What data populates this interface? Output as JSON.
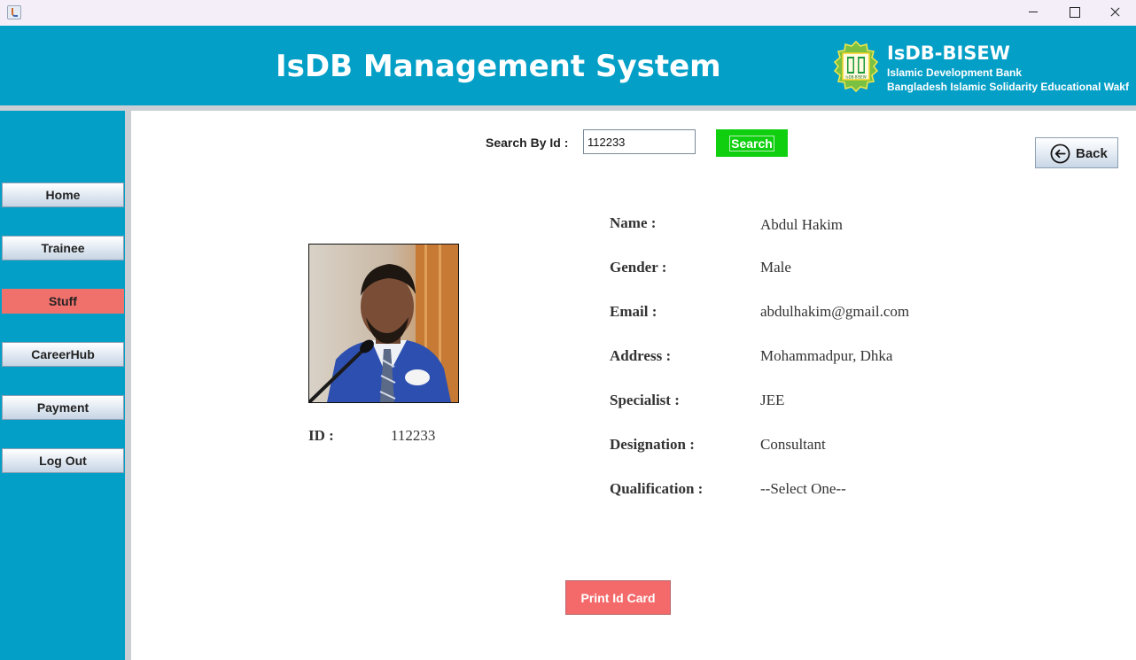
{
  "window": {
    "title": "",
    "icon": "java-cup-icon",
    "controls": [
      "minimize-icon",
      "maximize-icon",
      "close-icon"
    ]
  },
  "header": {
    "title": "IsDB Management System",
    "brand": {
      "name": "IsDB-BISEW",
      "line1": "Islamic Development Bank",
      "line2": "Bangladesh Islamic Solidarity Educational Wakf",
      "logo_text": "IsDB-BISEW"
    }
  },
  "sidebar": {
    "items": [
      {
        "label": "Home"
      },
      {
        "label": "Trainee"
      },
      {
        "label": "Stuff"
      },
      {
        "label": "CareerHub"
      },
      {
        "label": "Payment"
      },
      {
        "label": "Log Out"
      }
    ],
    "active": "Stuff"
  },
  "search": {
    "label": "Search By Id :",
    "value": "112233",
    "button_label": "Search"
  },
  "back": {
    "label": "Back",
    "icon": "arrow-left-circle-icon"
  },
  "profile": {
    "photo": "staff-photo",
    "id_label": "ID :",
    "id_value": "112233",
    "fields": [
      {
        "label": "Name :",
        "value": "Abdul Hakim"
      },
      {
        "label": "Gender :",
        "value": "Male"
      },
      {
        "label": "Email :",
        "value": "abdulhakim@gmail.com"
      },
      {
        "label": "Address :",
        "value": "Mohammadpur, Dhka"
      },
      {
        "label": "Specialist :",
        "value": "JEE"
      },
      {
        "label": "Designation :",
        "value": "Consultant"
      },
      {
        "label": "Qualification :",
        "value": "--Select One--"
      }
    ]
  },
  "print_button": {
    "label": "Print Id Card"
  },
  "colors": {
    "header": "#049fc7",
    "sidebar": "#049fc7",
    "active_nav": "#f0706c",
    "search_button": "#0fcf0f",
    "print_button": "#f4696a",
    "divider": "#c9cfd4"
  }
}
